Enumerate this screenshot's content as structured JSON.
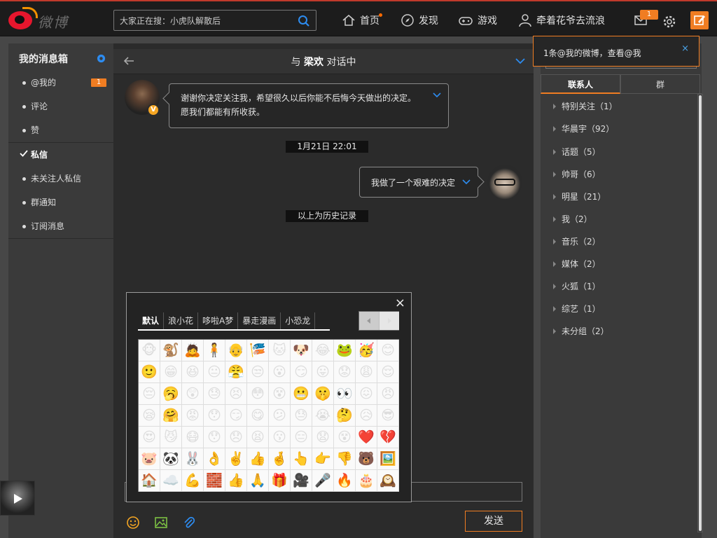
{
  "header": {
    "logo_text": "微博",
    "search_placeholder": "大家正在搜：小虎队解散后",
    "nav": {
      "home": "首页",
      "discover": "发现",
      "game": "游戏",
      "user": "牵着花爷去流浪"
    },
    "mail_badge": "1"
  },
  "sidebar": {
    "title": "我的消息箱",
    "items": [
      {
        "label": "@我的",
        "count": "1"
      },
      {
        "label": "评论"
      },
      {
        "label": "赞"
      },
      {
        "label": "私信",
        "active": true
      },
      {
        "label": "未关注人私信"
      },
      {
        "label": "群通知"
      },
      {
        "label": "订阅消息"
      }
    ]
  },
  "chat": {
    "title_prefix": "与",
    "title_name": "梁欢",
    "title_suffix": "对话中",
    "messages": [
      {
        "side": "left",
        "text": "谢谢你决定关注我，希望很久以后你能不后悔今天做出的决定。愿我们都能有所收获。"
      },
      {
        "side": "right",
        "text": "我做了一个艰难的决定"
      }
    ],
    "timestamp": "1月21日 22:01",
    "history_note": "以上为历史记录",
    "send_label": "发送"
  },
  "emoji_panel": {
    "tabs": [
      "默认",
      "浪小花",
      "哆啦A梦",
      "暴走漫画",
      "小恐龙"
    ],
    "active_tab": "默认",
    "close_symbol": "×",
    "emojis": [
      "🐵",
      "🐒",
      "🙇",
      "🧍",
      "👴",
      "🎏",
      "🐱",
      "🐶",
      "😂",
      "🐸",
      "🥳",
      "😊",
      "🙂",
      "😁",
      "😆",
      "😐",
      "😤",
      "😒",
      "😮",
      "😏",
      "😛",
      "😟",
      "😩",
      "😌",
      "😔",
      "🥱",
      "😲",
      "😓",
      "😣",
      "😳",
      "😵",
      "😬",
      "🤫",
      "👀",
      "😖",
      "😠",
      "😪",
      "🤗",
      "😡",
      "😯",
      "😏",
      "😋",
      "😕",
      "😓",
      "😭",
      "🤔",
      "😥",
      "😎",
      "😍",
      "😼",
      "😷",
      "😯",
      "😞",
      "😫",
      "😗",
      "😑",
      "😧",
      "😵",
      "❤️",
      "💔",
      "🐷",
      "🐼",
      "🐰",
      "👌",
      "✌️",
      "👍",
      "🤞",
      "👆",
      "👉",
      "👎",
      "🐻",
      "🖼️",
      "🏠",
      "☁️",
      "💪",
      "🧱",
      "👍",
      "🙏",
      "🎁",
      "🎥",
      "🎤",
      "🔥",
      "🎂",
      "🕰️"
    ]
  },
  "right_panel": {
    "notification": "1条@我的微博，查看@我",
    "notification_close": "×",
    "tabs": [
      "联系人",
      "群"
    ],
    "groups": [
      "特别关注（1）",
      "华晨宇（92）",
      "话题（5）",
      "帅哥（6）",
      "明星（21）",
      "我（2）",
      "音乐（2）",
      "媒体（2）",
      "火狐（1）",
      "综艺（1）",
      "未分组（2）"
    ]
  },
  "colors": {
    "accent": "#f07d22",
    "link": "#4aa3e8",
    "topbar": "#1c1c1c",
    "brand_red": "#e6162d"
  }
}
